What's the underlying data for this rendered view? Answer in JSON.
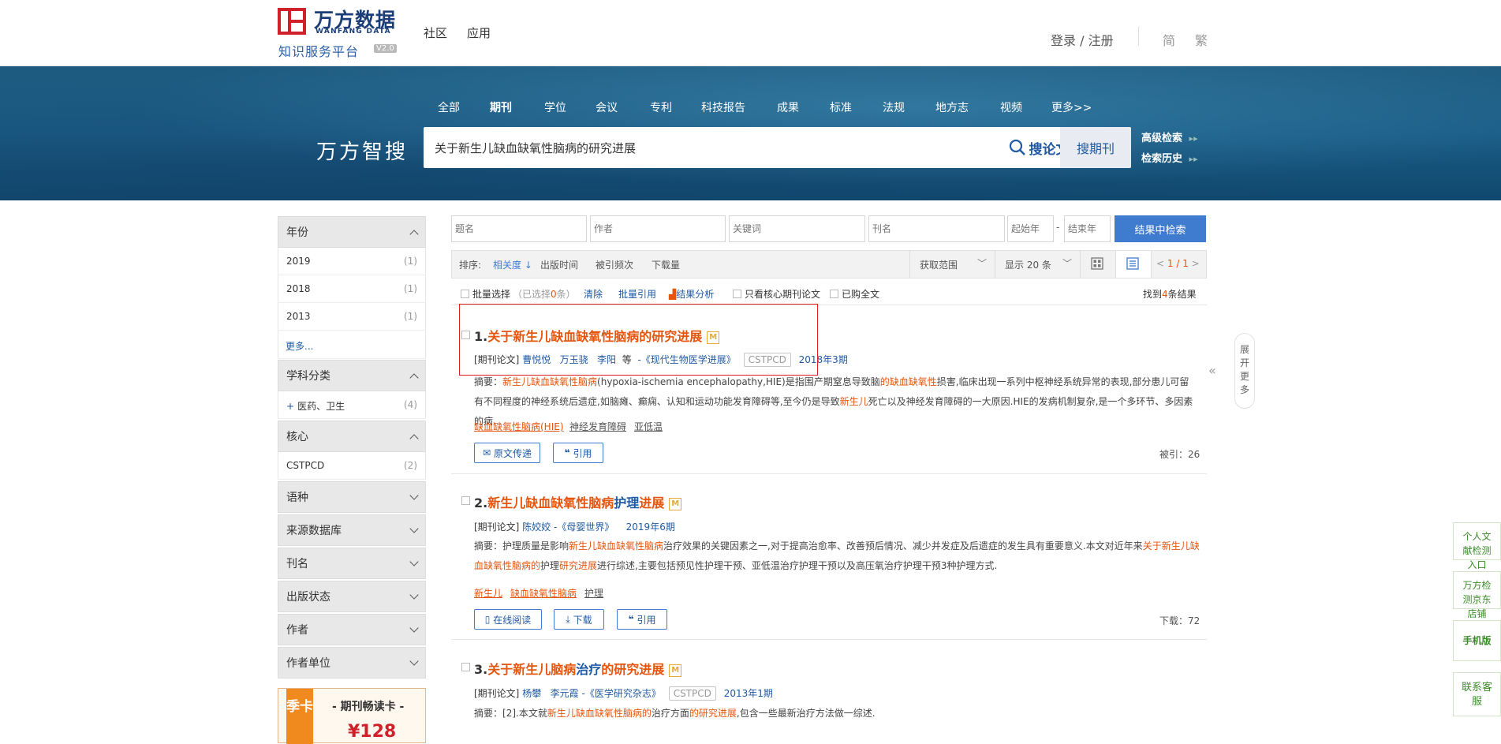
{
  "header": {
    "logo_cn": "万方数据",
    "logo_en": "WANFANG DATA",
    "logo_sub": "知识服务平台",
    "logo_version": "V2.0",
    "nav": [
      "社区",
      "应用"
    ],
    "login": "登录 / 注册",
    "lang_simplified": "简",
    "lang_traditional": "繁"
  },
  "banner": {
    "categories": [
      "全部",
      "期刊",
      "学位",
      "会议",
      "专利",
      "科技报告",
      "成果",
      "标准",
      "法规",
      "地方志",
      "视频",
      "更多>>"
    ],
    "active_category": "期刊",
    "brand": "万方智搜",
    "search_value": "关于新生儿缺血缺氧性脑病的研究进展",
    "btn_search_papers": "搜论文",
    "btn_search_journals": "搜期刊",
    "advanced": "高级检索",
    "history": "检索历史"
  },
  "sidebar": {
    "year": {
      "title": "年份",
      "items": [
        {
          "label": "2019",
          "count": "(1)"
        },
        {
          "label": "2018",
          "count": "(1)"
        },
        {
          "label": "2013",
          "count": "(1)"
        }
      ],
      "more": "更多..."
    },
    "subject": {
      "title": "学科分类",
      "items": [
        {
          "label": "医药、卫生",
          "count": "(4)"
        }
      ]
    },
    "core": {
      "title": "核心",
      "items": [
        {
          "label": "CSTPCD",
          "count": "(2)"
        }
      ]
    },
    "collapsed": [
      "语种",
      "来源数据库",
      "刊名",
      "出版状态",
      "作者",
      "作者单位"
    ],
    "promo": {
      "tag": "季卡",
      "title": "- 期刊畅读卡 -",
      "price": "¥128"
    }
  },
  "filters": {
    "title_ph": "题名",
    "author_ph": "作者",
    "keyword_ph": "关键词",
    "journal_ph": "刊名",
    "start_year_ph": "起始年",
    "dash": "-",
    "end_year_ph": "结束年",
    "btn": "结果中检索"
  },
  "sortbar": {
    "label": "排序:",
    "relevance": "相关度",
    "pub_time": "出版时间",
    "cited": "被引频次",
    "downloads": "下载量",
    "scope": "获取范围",
    "show": "显示 20 条",
    "page": "1 / 1"
  },
  "toolbar": {
    "batch_select": "批量选择",
    "selected": "（已选择",
    "selected_count": "0",
    "selected_unit": "条）",
    "clear": "清除",
    "batch_cite": "批量引用",
    "analysis": "结果分析",
    "core_only": "只看核心期刊论文",
    "purchased": "已购全文",
    "found_prefix": "找到",
    "found_count": "4",
    "found_suffix": "条结果"
  },
  "results": [
    {
      "num": "1.",
      "title": "关于新生儿缺血缺氧性脑病的研究进展",
      "m": "M",
      "type": "[期刊论文]",
      "authors": [
        "曹悦悦",
        "万玉骁",
        "李阳"
      ],
      "etal": "等",
      "journal": "-《现代生物医学进展》",
      "badge": "CSTPCD",
      "date": "2018年3期",
      "abstract_label": "摘要：",
      "abstract_hl1": "新生儿缺血缺氧性脑病",
      "abstract_t1": "(hypoxia-ischemia encephalopathy,HIE)是指围产期窒息导致脑",
      "abstract_hl2": "的缺血缺氧性",
      "abstract_t2": "损害,临床出现一系列中枢神经系统异常的表现,部分患儿可留有不同程度的神经系统后遗症,如脑瘫、癫痫、认知和运动功能发育障碍等,至今仍是导致",
      "abstract_hl3": "新生儿",
      "abstract_t3": "死亡以及神经发育障碍的一大原因.HIE的发病机制复杂,是一个多环节、多因素的病...",
      "keywords": [
        "缺血缺氧性脑病(HIE)",
        "神经发育障碍",
        "亚低温"
      ],
      "btn_a": "原文传递",
      "btn_b": "引用",
      "stat": "被引：26"
    },
    {
      "num": "2.",
      "title_a": "新生儿缺血缺氧性脑病",
      "title_b": "护理",
      "title_c": "进展",
      "m": "M",
      "type": "[期刊论文]",
      "authors": [
        "陈姣姣"
      ],
      "journal": "-《母婴世界》",
      "date": "2019年6期",
      "abstract_label": "摘要：",
      "abstract_t1": "护理质量是影响",
      "abstract_hl1": "新生儿缺血缺氧性脑病",
      "abstract_t2": "治疗效果的关键因素之一,对于提高治愈率、改善预后情况、减少并发症及后遗症的发生具有重要意义.本文对近年来",
      "abstract_hl2": "关于新生儿缺血缺氧性脑病的",
      "abstract_t3": "护理",
      "abstract_hl3": "研究进展",
      "abstract_t4": "进行综述,主要包括预见性护理干预、亚低温治疗护理干预以及高压氧治疗护理干预3种护理方式.",
      "keywords": [
        "新生儿",
        "缺血缺氧性脑病",
        "护理"
      ],
      "btn_a": "在线阅读",
      "btn_b": "下载",
      "btn_c": "引用",
      "stat": "下载：72"
    },
    {
      "num": "3.",
      "title_a": "关于新生儿脑病",
      "title_b": "治疗",
      "title_c": "的研究进展",
      "m": "M",
      "type": "[期刊论文]",
      "authors": [
        "杨攀",
        "李元霞"
      ],
      "journal": "-《医学研究杂志》",
      "badge": "CSTPCD",
      "date": "2013年1期",
      "abstract_label": "摘要：",
      "abstract_t1": "[2].本文就",
      "abstract_hl1": "新生儿缺血缺氧性脑病的",
      "abstract_t2": "治疗方面",
      "abstract_hl2": "的研究进展",
      "abstract_t3": ",包含一些最新治疗方法做一综述."
    }
  ],
  "right": {
    "expand": [
      "展",
      "开",
      "更",
      "多"
    ],
    "collapse_arrow": "«",
    "side": [
      "个人文献检测入口",
      "万方检测京东店铺",
      "手机版",
      "联系客服"
    ]
  }
}
